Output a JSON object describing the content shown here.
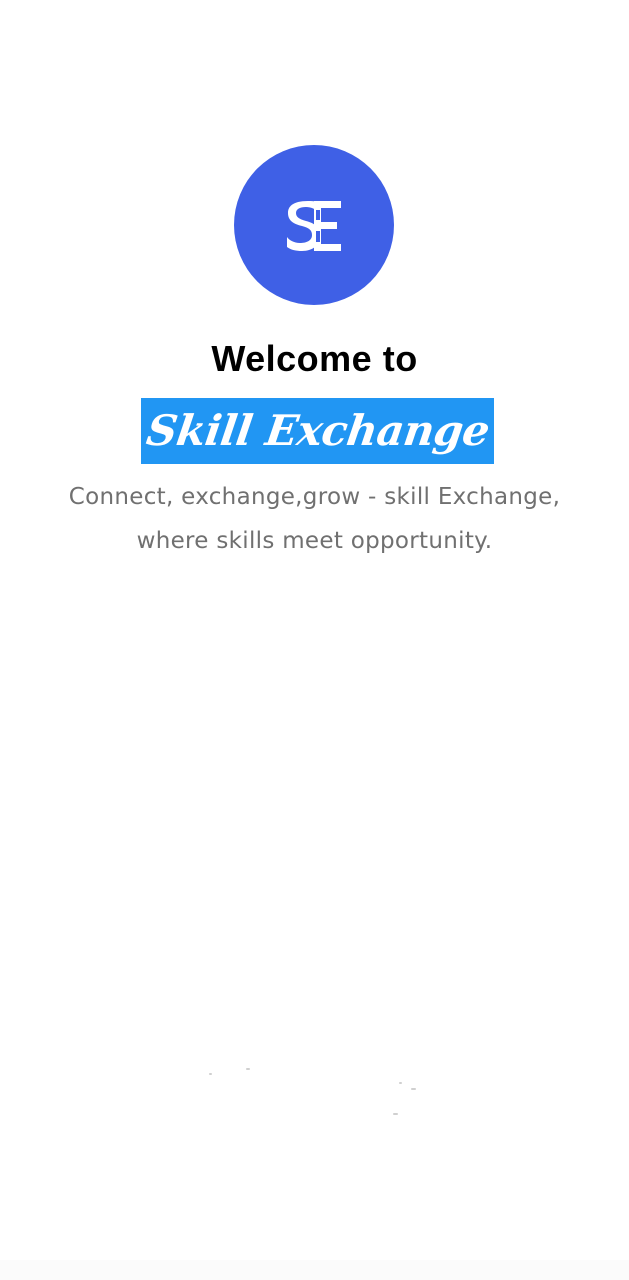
{
  "logo": {
    "text": "SE",
    "background_color": "#3f60e6",
    "icon": "skill-exchange-logo-icon"
  },
  "welcome": {
    "title": "Welcome to"
  },
  "brand": {
    "name": "Skill Exchange",
    "highlight_color": "#2196f3",
    "text_color": "#ffffff"
  },
  "tagline": {
    "line1": "Connect, exchange,grow - skill Exchange,",
    "line2": "where skills meet opportunity.",
    "color": "#707070"
  }
}
